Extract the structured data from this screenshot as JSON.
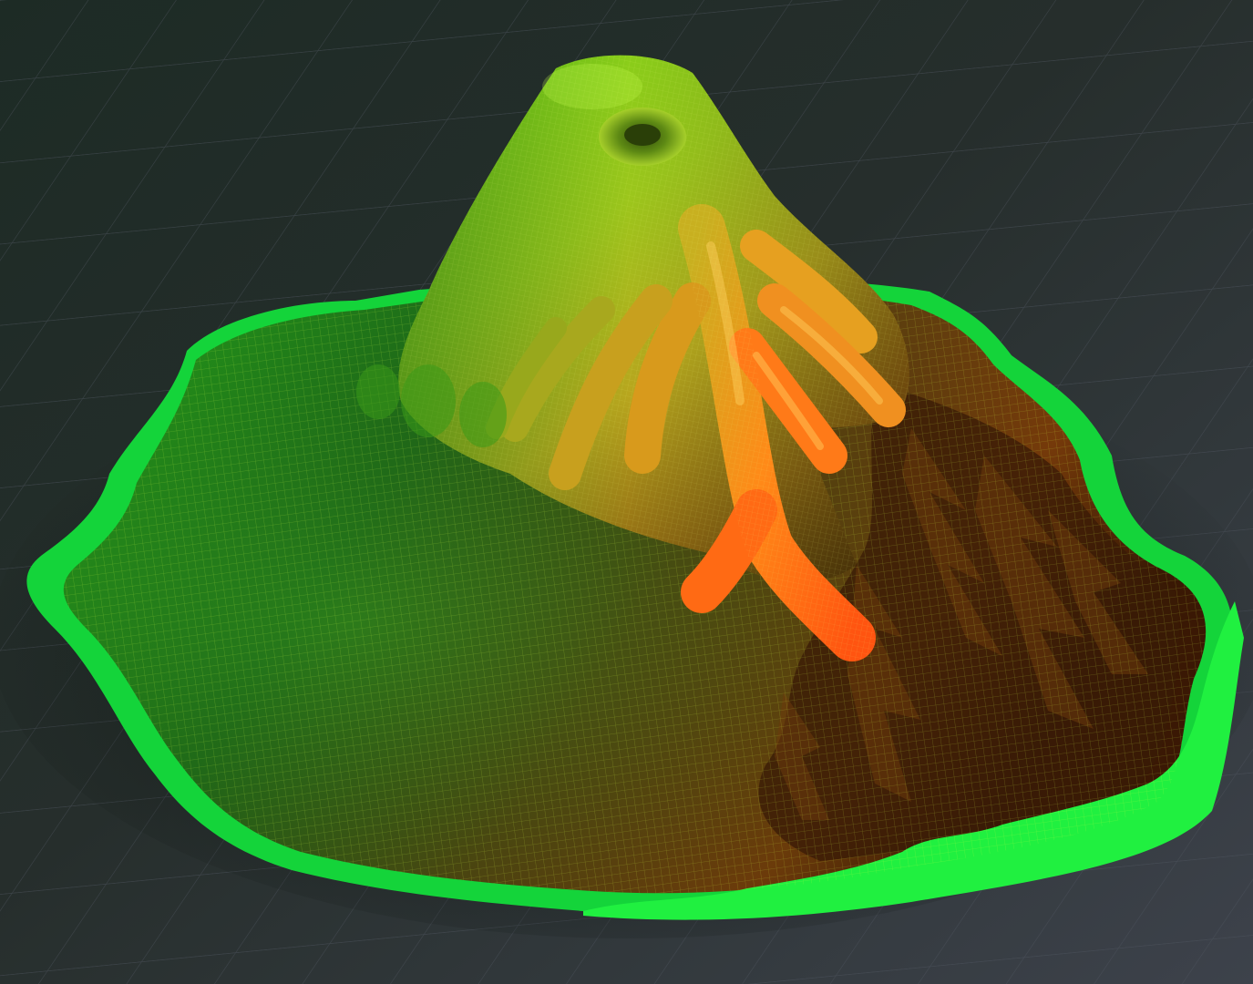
{
  "scene": {
    "subject": "volcano-wireframe-mesh",
    "colors": {
      "background_dark": "#1f2a26",
      "background_light": "#3a3f47",
      "grid_line": "#4a4f58",
      "mesh_green": "#22d62a",
      "mesh_lime": "#8fd21a",
      "mesh_orange": "#ff6a10",
      "mesh_brown": "#3a1e08",
      "rim_green": "#13e83a"
    }
  }
}
